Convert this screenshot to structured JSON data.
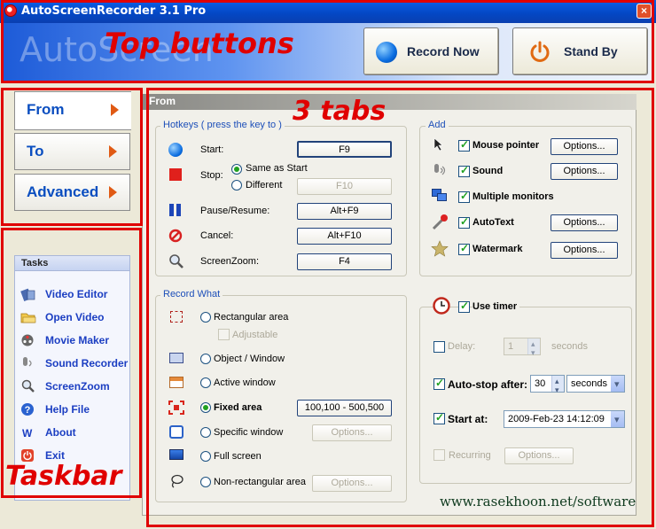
{
  "window": {
    "title": "AutoScreenRecorder 3.1 Pro",
    "close": "×"
  },
  "header": {
    "logo": "AutoScreen",
    "record_now": "Record Now",
    "stand_by": "Stand By"
  },
  "annotations": {
    "top_buttons": "Top buttons",
    "tabs": "3 tabs",
    "taskbar": "Taskbar",
    "accent": "#e00000"
  },
  "tabs": [
    {
      "label": "From",
      "active": true
    },
    {
      "label": "To",
      "active": false
    },
    {
      "label": "Advanced",
      "active": false
    }
  ],
  "panel_header": "From",
  "hotkeys": {
    "title": "Hotkeys ( press the key to )",
    "start_label": "Start:",
    "start_key": "F9",
    "stop_label": "Stop:",
    "same_as_start": "Same as Start",
    "different": "Different",
    "stop_key": "F10",
    "pause_label": "Pause/Resume:",
    "pause_key": "Alt+F9",
    "cancel_label": "Cancel:",
    "cancel_key": "Alt+F10",
    "zoom_label": "ScreenZoom:",
    "zoom_key": "F4"
  },
  "record_what": {
    "title": "Record What",
    "rectangular": "Rectangular area",
    "adjustable": "Adjustable",
    "object_window": "Object / Window",
    "active_window": "Active window",
    "fixed_area": "Fixed area",
    "fixed_area_value": "100,100 - 500,500",
    "specific_window": "Specific window",
    "full_screen": "Full screen",
    "non_rect": "Non-rectangular area",
    "options": "Options...",
    "selected": "Fixed area"
  },
  "add": {
    "title": "Add",
    "mouse_pointer": "Mouse pointer",
    "sound": "Sound",
    "multiple_monitors": "Multiple monitors",
    "autotext": "AutoText",
    "watermark": "Watermark",
    "options": "Options..."
  },
  "timer": {
    "use_timer": "Use timer",
    "delay": "Delay:",
    "delay_value": "1",
    "delay_unit": "seconds",
    "auto_stop": "Auto-stop after:",
    "auto_stop_value": "30",
    "auto_stop_unit": "seconds",
    "start_at": "Start at:",
    "start_at_value": "2009-Feb-23 14:12:09",
    "recurring": "Recurring",
    "options": "Options..."
  },
  "watermark_text": "www.rasekhoon.net/software",
  "tasks": {
    "title": "Tasks",
    "items": [
      {
        "label": "Video Editor",
        "icon": "film-icon"
      },
      {
        "label": "Open Video",
        "icon": "folder-icon"
      },
      {
        "label": "Movie Maker",
        "icon": "reel-icon"
      },
      {
        "label": "Sound Recorder",
        "icon": "microphone-icon"
      },
      {
        "label": "ScreenZoom",
        "icon": "magnifier-icon"
      },
      {
        "label": "Help File",
        "icon": "help-icon"
      },
      {
        "label": "About",
        "icon": "w-icon"
      },
      {
        "label": "Exit",
        "icon": "exit-icon"
      }
    ]
  }
}
